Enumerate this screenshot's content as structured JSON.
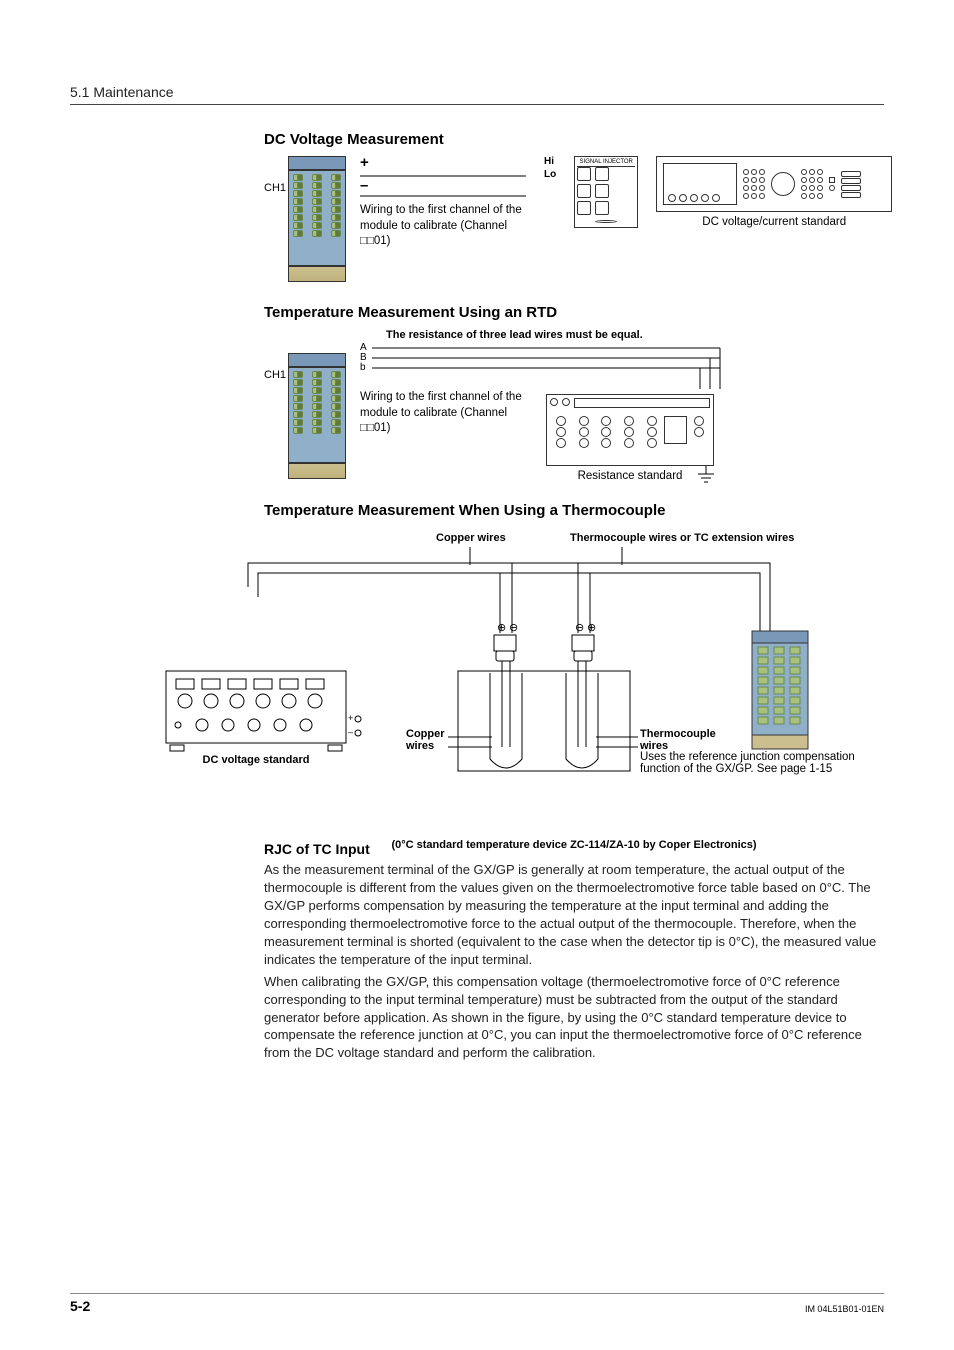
{
  "header": {
    "section": "5.1  Maintenance"
  },
  "sec1": {
    "title": "DC Voltage Measurement",
    "ch": "CH1",
    "plus": "+",
    "minus": "–",
    "hi": "Hi",
    "lo": "Lo",
    "wiring": "Wiring to the first channel of the module to calibrate (Channel □□01)",
    "sig_inj_title": "SIGNAL INJECTOR",
    "dc_std_caption": "DC voltage/current standard"
  },
  "sec2": {
    "title": "Temperature Measurement Using an RTD",
    "ch": "CH1",
    "note": "The resistance of three lead wires must be equal.",
    "a": "A",
    "B": "B",
    "b": "b",
    "wiring": "Wiring to the first channel of the module to calibrate (Channel □□01)",
    "res_caption": "Resistance standard"
  },
  "sec3": {
    "title": "Temperature Measurement When Using a Thermocouple",
    "copper_top": "Copper wires",
    "tc_top": "Thermocouple wires or TC extension wires",
    "copper_lbl": "Copper wires",
    "tc_lbl": "Thermocouple wires",
    "dc_std_lbl": "DC voltage standard",
    "rjc_note": "Uses the reference junction compensation function of the GX/GP. See page 1-15",
    "device_caption": "(0°C standard temperature device ZC-114/ZA-10 by Coper Electronics)"
  },
  "sec4": {
    "title": "RJC of TC Input",
    "p1": "As the measurement terminal of the GX/GP is generally at room temperature, the actual output of the thermocouple is different from the values given on the thermoelectromotive force table based on 0°C. The GX/GP performs compensation by measuring the temperature at the input terminal and adding the corresponding thermoelectromotive force to the actual output of the thermocouple. Therefore, when the measurement terminal is shorted (equivalent to the case when the detector tip is 0°C), the measured value indicates the temperature of the input terminal.",
    "p2": "When calibrating the GX/GP, this compensation voltage (thermoelectromotive force of 0°C reference corresponding to the input terminal temperature) must be subtracted from the output of the standard generator before application. As shown in the figure, by using the 0°C standard temperature device to compensate the reference junction at 0°C, you can input the thermoelectromotive force of 0°C reference from the DC voltage standard and perform the calibration."
  },
  "footer": {
    "page": "5-2",
    "doc": "IM 04L51B01-01EN"
  }
}
